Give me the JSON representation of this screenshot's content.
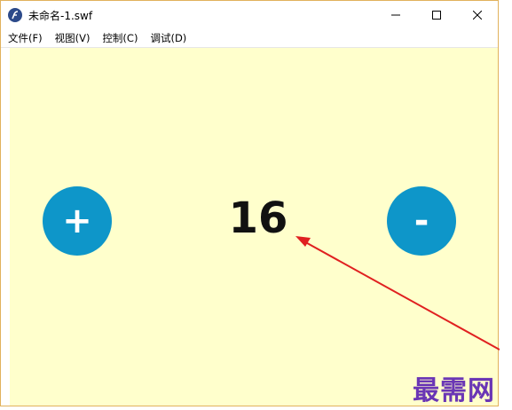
{
  "window": {
    "title": "未命名-1.swf",
    "app_icon": "flash-player-icon"
  },
  "window_controls": {
    "minimize_icon": "minimize-icon",
    "maximize_icon": "maximize-icon",
    "close_icon": "close-icon"
  },
  "menu": {
    "items": [
      {
        "label": "文件(F)"
      },
      {
        "label": "视图(V)"
      },
      {
        "label": "控制(C)"
      },
      {
        "label": "调试(D)"
      }
    ]
  },
  "stage": {
    "background_color": "#ffffcc",
    "plus_label": "+",
    "minus_label": "-",
    "counter_value": "16",
    "button_color": "#0e96c9"
  },
  "annotation": {
    "arrow_color": "#e02020"
  },
  "watermark": {
    "text": "最需网"
  }
}
